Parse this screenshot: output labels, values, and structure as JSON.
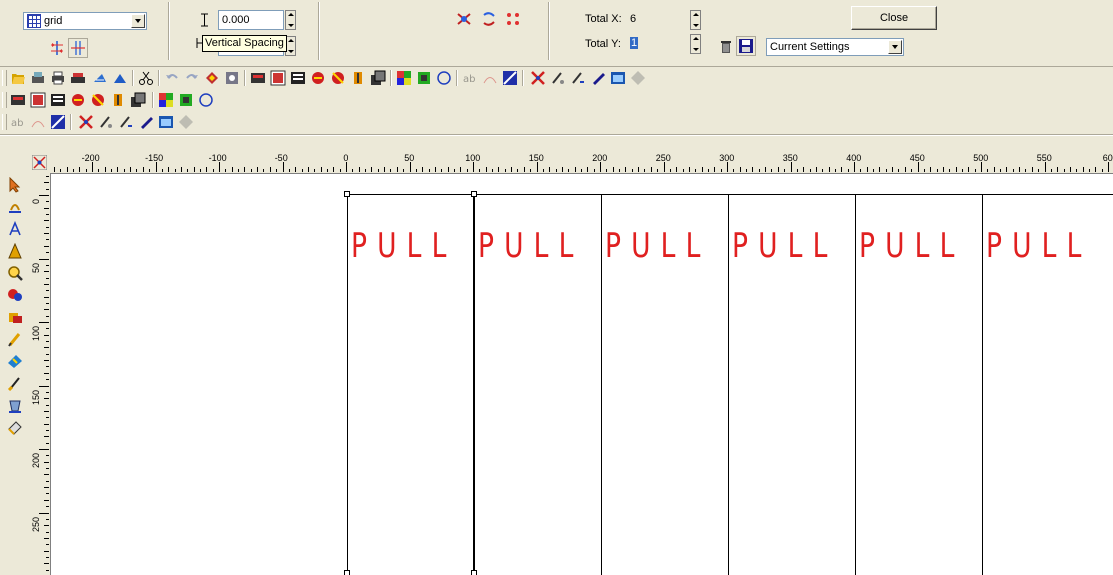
{
  "property_bar": {
    "layout_dropdown": "grid",
    "spacing_value": "0.000",
    "tooltip": "Vertical Spacing",
    "total_x_label": "Total X:",
    "total_x_value": "6",
    "total_y_label": "Total Y:",
    "total_y_value": "1",
    "settings_dropdown": "Current Settings",
    "close_label": "Close"
  },
  "rulers": {
    "horizontal": [
      "-200",
      "-150",
      "-100",
      "-50",
      "0",
      "50",
      "100",
      "150",
      "200",
      "250",
      "300",
      "350",
      "400",
      "450",
      "500",
      "550",
      "60"
    ],
    "vertical": [
      "0",
      "50",
      "100",
      "150",
      "200",
      "250",
      "3"
    ]
  },
  "canvas": {
    "cells": [
      "PULL",
      "PULL",
      "PULL",
      "PULL",
      "PULL",
      "PULL"
    ],
    "text_color": "#e02020"
  },
  "icons": {
    "toolbar1": [
      "open-icon",
      "scan-icon",
      "print-icon",
      "plot-icon",
      "cut-icon",
      "pen-icon",
      "scissors-icon",
      "undo-icon",
      "redo-icon",
      "mirror-icon",
      "rotate-icon",
      "align-icon",
      "table-icon",
      "layout-icon",
      "weed-icon",
      "color-icon",
      "shadow-icon",
      "stack-icon",
      "fill-icon",
      "contour-icon",
      "circle-icon",
      "text-icon",
      "text-path-icon",
      "shape-icon",
      "delete-node-icon",
      "brush-icon",
      "eraser-icon",
      "pencil-icon",
      "window-icon",
      "settings-icon"
    ],
    "toolbox": [
      "select-icon",
      "node-icon",
      "text-tool-icon",
      "fill-text-icon",
      "zoom-icon",
      "ellipse-icon",
      "rectangle-icon",
      "pen-tool-icon",
      "cut-path-icon",
      "brush-tool-icon",
      "bucket-icon",
      "eraser-tool-icon"
    ]
  }
}
